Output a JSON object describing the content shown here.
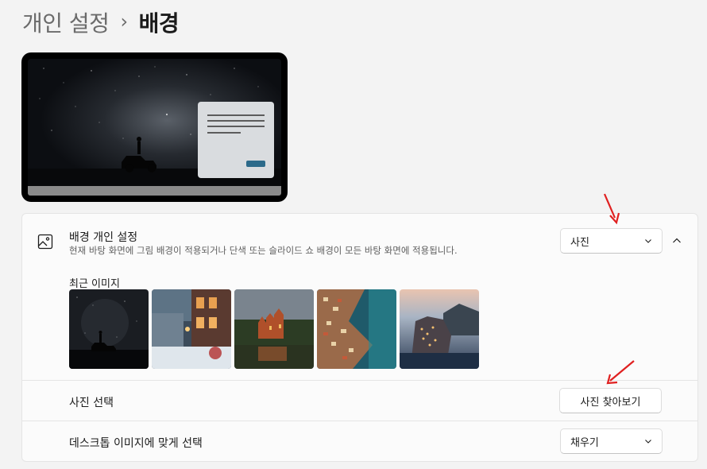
{
  "breadcrumb": {
    "parent": "개인 설정",
    "separator": "›",
    "current": "배경"
  },
  "background_card": {
    "title": "배경 개인 설정",
    "description": "현재 바탕 화면에 그림 배경이 적용되거나 단색 또는 슬라이드 쇼 배경이 모든 바탕 화면에 적용됩니다.",
    "dropdown_value": "사진",
    "expanded": true
  },
  "recent": {
    "label": "최근 이미지",
    "images": [
      {
        "name": "night-sky-car"
      },
      {
        "name": "snowy-street"
      },
      {
        "name": "castle-lake"
      },
      {
        "name": "coastal-town"
      },
      {
        "name": "cliff-village-dusk"
      }
    ]
  },
  "choose_photo": {
    "label": "사진 선택",
    "button_label": "사진 찾아보기"
  },
  "fit": {
    "label": "데스크톱 이미지에 맞게 선택",
    "dropdown_value": "채우기"
  },
  "colors": {
    "accent": "#2c6a8a",
    "annotation_arrow": "#e02020"
  }
}
